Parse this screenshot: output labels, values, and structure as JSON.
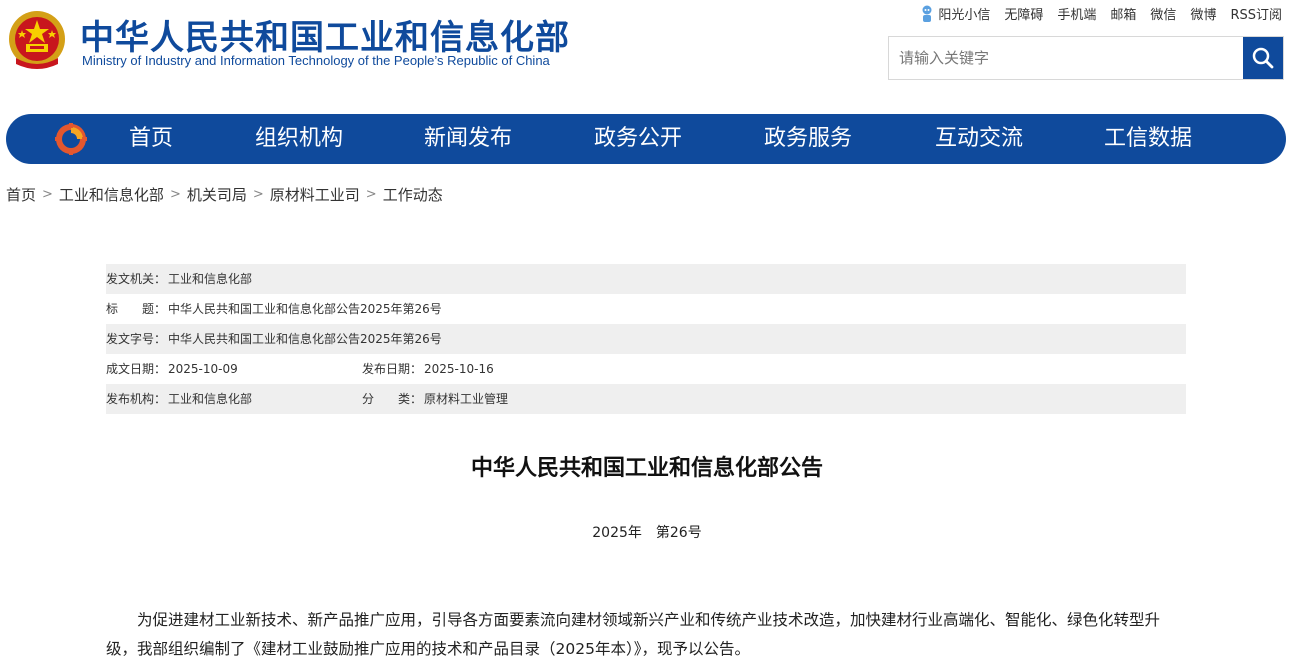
{
  "header": {
    "title_cn": "中华人民共和国工业和信息化部",
    "title_en": "Ministry of Industry and Information Technology of the People’s Republic of China",
    "emblem_icon": "national-emblem-icon",
    "brand_color": "#0f4a9c"
  },
  "toplinks": {
    "sunshine": "阳光小信",
    "accessibility": "无障碍",
    "mobile": "手机端",
    "mail": "邮箱",
    "wechat": "微信",
    "weibo": "微博",
    "rss": "RSS订阅"
  },
  "search": {
    "placeholder": "请输入关键字",
    "icon": "search-icon"
  },
  "nav": {
    "items": [
      "首页",
      "组织机构",
      "新闻发布",
      "政务公开",
      "政务服务",
      "互动交流",
      "工信数据"
    ]
  },
  "breadcrumb": [
    "首页",
    "工业和信息化部",
    "机关司局",
    "原材料工业司",
    "工作动态"
  ],
  "breadcrumb_sep": ">",
  "meta": {
    "issuer_label": "发文机关：",
    "issuer": "工业和信息化部",
    "title_label": "标　　题：",
    "title": "中华人民共和国工业和信息化部公告2025年第26号",
    "docno_label": "发文字号：",
    "docno": "中华人民共和国工业和信息化部公告2025年第26号",
    "written_label": "成文日期：",
    "written": "2025-10-09",
    "published_label": "发布日期：",
    "published": "2025-10-16",
    "org_label": "发布机构：",
    "org": "工业和信息化部",
    "category_label": "分　　类：",
    "category": "原材料工业管理"
  },
  "article": {
    "title": "中华人民共和国工业和信息化部公告",
    "number": "2025年　第26号",
    "paragraph": "为促进建材工业新技术、新产品推广应用，引导各方面要素流向建材领域新兴产业和传统产业技术改造，加快建材行业高端化、智能化、绿色化转型升级，我部组织编制了《建材工业鼓励推广应用的技术和产品目录（2025年本）》，现予以公告。"
  }
}
